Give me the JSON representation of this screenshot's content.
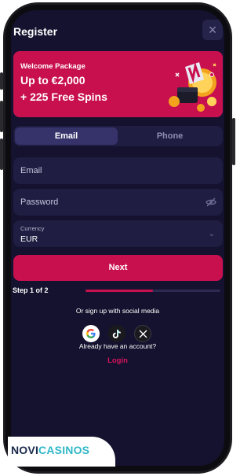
{
  "header": {
    "title": "Register",
    "close_glyph": "×"
  },
  "banner": {
    "small": "Welcome Package",
    "line1": "Up to €2,000",
    "line2": "+ 225 Free Spins"
  },
  "tabs": [
    {
      "label": "Email",
      "active": true
    },
    {
      "label": "Phone",
      "active": false
    }
  ],
  "form": {
    "email_placeholder": "Email",
    "password_placeholder": "Password",
    "currency_label": "Currency",
    "currency_value": "EUR"
  },
  "next_label": "Next",
  "step": {
    "label": "Step 1 of 2",
    "progress": 0.5
  },
  "social": {
    "text": "Or sign up with social media",
    "providers": [
      "google-icon",
      "tiktok-icon",
      "x-icon"
    ]
  },
  "account": {
    "text": "Already have an account?",
    "login": "Login"
  },
  "footer": {
    "logo_part1": "NOVI",
    "logo_part2": "CASINOS"
  },
  "colors": {
    "brand": "#c8104f",
    "background": "#14122e",
    "field": "#1f1d41"
  }
}
